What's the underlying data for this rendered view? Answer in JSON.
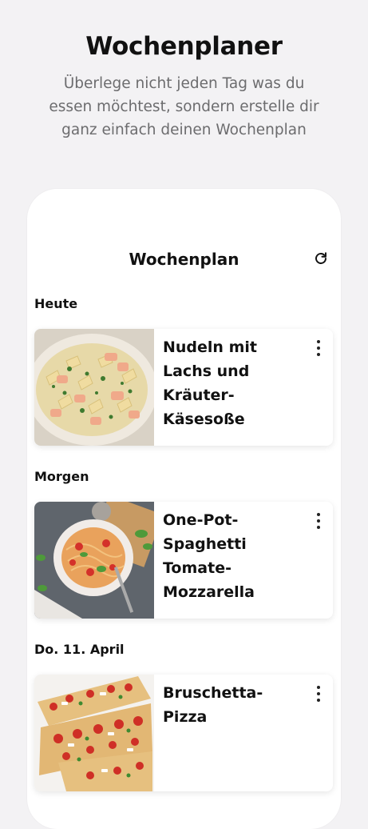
{
  "hero": {
    "title": "Wochenplaner",
    "subtitle": "Überlege nicht jeden Tag was du essen möchtest, sondern erstelle dir ganz einfach deinen Wochenplan"
  },
  "plan": {
    "title": "Wochenplan",
    "refresh_icon": "refresh-icon",
    "days": [
      {
        "label": "Heute",
        "recipe": "Nudeln mit Lachs und Kräuter-Käsesoße",
        "image": "farfalle-salmon-dish"
      },
      {
        "label": "Morgen",
        "recipe": "One-Pot-Spaghetti Tomate-Mozzarella",
        "image": "spaghetti-tomato-dish"
      },
      {
        "label": "Do. 11. April",
        "recipe": "Bruschetta-Pizza",
        "image": "bruschetta-pizza-dish"
      }
    ]
  },
  "colors": {
    "background": "#f3f2f4",
    "card": "#ffffff",
    "text": "#111111",
    "subtitle": "#6c6c6e"
  }
}
